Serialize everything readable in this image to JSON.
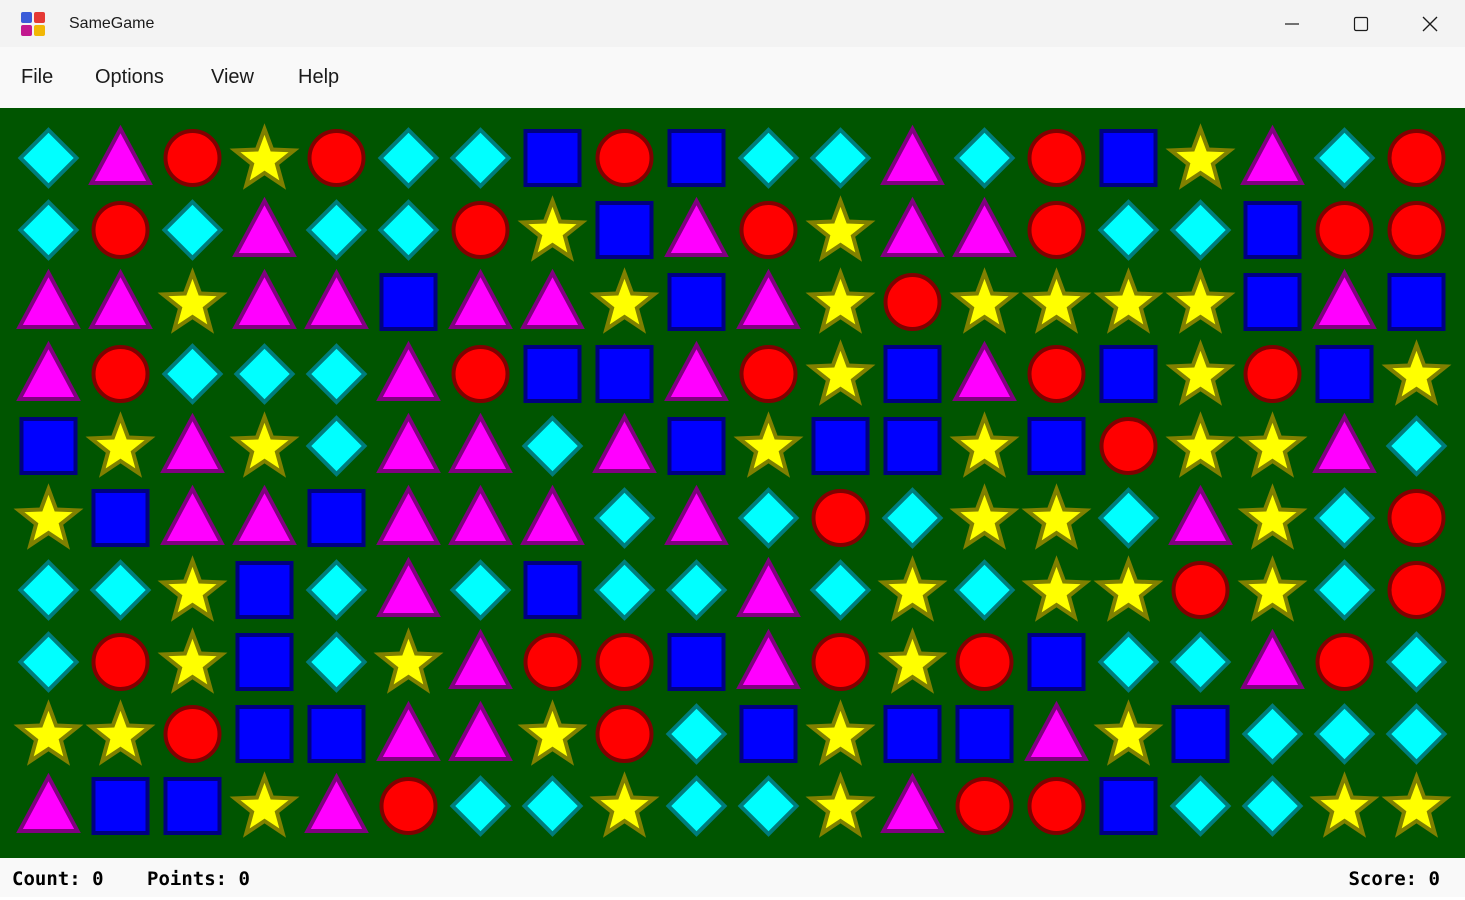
{
  "window": {
    "title": "SameGame",
    "icon": "samegame-app-icon"
  },
  "menu": [
    {
      "label": "File"
    },
    {
      "label": "Options"
    },
    {
      "label": "View"
    },
    {
      "label": "Help"
    }
  ],
  "board": {
    "background": "#005500",
    "rows": 10,
    "columns": 20,
    "legend": {
      "D": "cyan-diamond",
      "T": "magenta-triangle",
      "C": "red-circle",
      "S": "yellow-star",
      "Q": "blue-square"
    },
    "colors": {
      "D": {
        "fill": "#00ffff",
        "stroke": "#007c7c"
      },
      "T": {
        "fill": "#ff00ff",
        "stroke": "#800080"
      },
      "C": {
        "fill": "#ff0000",
        "stroke": "#800000"
      },
      "S": {
        "fill": "#ffff00",
        "stroke": "#808000"
      },
      "Q": {
        "fill": "#0000ff",
        "stroke": "#000080"
      }
    },
    "grid": [
      "DTCSCDDQCQDDTDCQSTDC",
      "DCDTDDCSQTCSTTCDDQCC",
      "TTSTTQTTSQTSCSSSSQTQ",
      "TCDDDTCQQTCSQTCQSCQS",
      "QSTSDTTDTQSQQSQCSSTD",
      "SQTTQTTTDTDCDSSDTSDC",
      "DDSQDTDQDDTDSDSSCSDC",
      "DCSQDSTCCQTCSCQDDTCD",
      "SSCQQTTSCDQSQQTSQDDD",
      "TQQSTCDDSDDSTCCQDDSS"
    ]
  },
  "status": {
    "count": "Count: 0",
    "points": "Points: 0",
    "score": "Score: 0"
  }
}
